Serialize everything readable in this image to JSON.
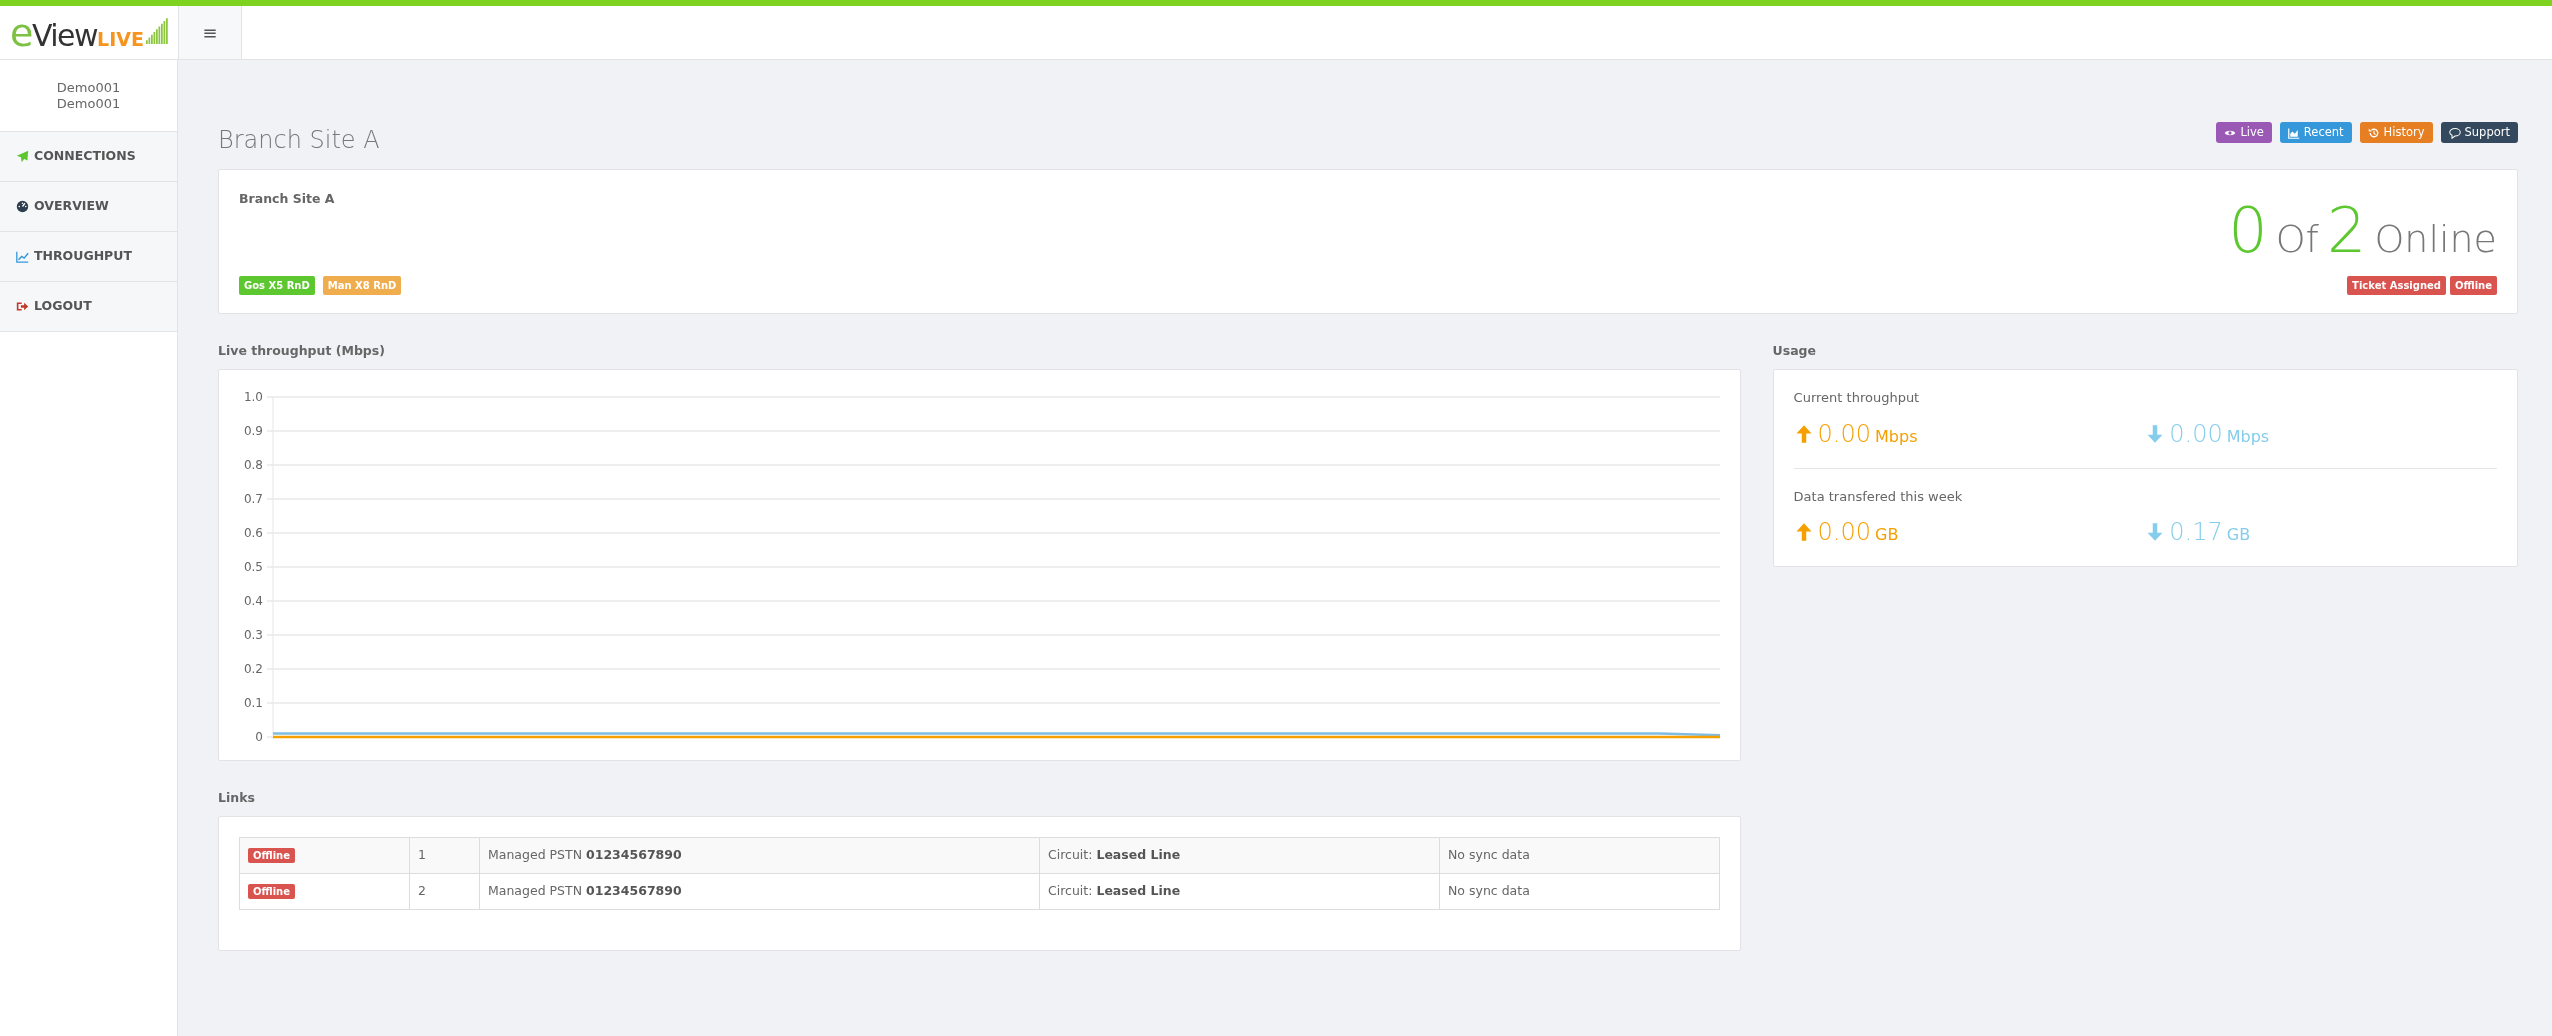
{
  "logo": {
    "mark": "e",
    "word": "View",
    "suffix": "LIVE"
  },
  "menu_button": "≡",
  "user": [
    "Demo001",
    "Demo001"
  ],
  "sidebar": {
    "items": [
      {
        "kind": "connections",
        "label": "CONNECTIONS"
      },
      {
        "kind": "overview",
        "label": "OVERVIEW"
      },
      {
        "kind": "throughput",
        "label": "THROUGHPUT"
      },
      {
        "kind": "logout",
        "label": "LOGOUT"
      }
    ]
  },
  "page_title": "Branch Site A",
  "view_buttons": [
    {
      "kind": "live",
      "label": "Live"
    },
    {
      "kind": "recent",
      "label": "Recent"
    },
    {
      "kind": "history",
      "label": "History"
    },
    {
      "kind": "support",
      "label": "Support"
    }
  ],
  "site": {
    "name": "Branch Site A",
    "online": "0",
    "of": "Of",
    "total": "2",
    "online_label": "Online",
    "tags": [
      {
        "label": "Gos X5 RnD",
        "color": "#5cc72e"
      },
      {
        "label": "Man X8 RnD",
        "color": "#f0ad4e"
      }
    ],
    "status_badges": [
      "Ticket Assigned",
      "Offline"
    ]
  },
  "throughput": {
    "label": "Live throughput (Mbps)",
    "chart_data": {
      "type": "line",
      "grid": true,
      "ylim": [
        0,
        1
      ],
      "yticks": [
        {
          "value": 0,
          "label": "0"
        },
        {
          "value": 0.1,
          "label": "0.1"
        },
        {
          "value": 0.2,
          "label": "0.2"
        },
        {
          "value": 0.3,
          "label": "0.3"
        },
        {
          "value": 0.4,
          "label": "0.4"
        },
        {
          "value": 0.5,
          "label": "0.5"
        },
        {
          "value": 0.6,
          "label": "0.6"
        },
        {
          "value": 0.7,
          "label": "0.7"
        },
        {
          "value": 0.8,
          "label": "0.8"
        },
        {
          "value": 0.9,
          "label": "0.9"
        },
        {
          "value": 1,
          "label": "1.0"
        }
      ],
      "series": [
        {
          "color": "#7dbde2",
          "values": [
            0.01,
            0.01,
            0.01,
            0.01,
            0.01,
            0.01,
            0.01,
            0.01,
            0.01,
            0.01,
            0.01,
            0.01,
            0.01,
            0.01,
            0.01,
            0.01,
            0.01,
            0.01,
            0.01,
            0.01,
            0.01,
            0.01,
            0.01,
            0.01,
            0.005
          ]
        },
        {
          "color": "#f5a000",
          "values": [
            0,
            0,
            0,
            0,
            0,
            0,
            0,
            0,
            0,
            0,
            0,
            0,
            0,
            0,
            0,
            0,
            0,
            0,
            0,
            0,
            0,
            0,
            0,
            0,
            0
          ]
        }
      ]
    }
  },
  "usage": {
    "label": "Usage",
    "sections": [
      {
        "label": "Current throughput",
        "stats": [
          {
            "kind": "up",
            "value": "0.00",
            "unit": "Mbps"
          },
          {
            "kind": "down",
            "value": "0.00",
            "unit": "Mbps"
          }
        ]
      },
      {
        "label": "Data transfered this week",
        "stats": [
          {
            "kind": "up",
            "value": "0.00",
            "unit": "GB"
          },
          {
            "kind": "down",
            "value": "0.17",
            "unit": "GB"
          }
        ]
      }
    ]
  },
  "links": {
    "label": "Links",
    "rows": [
      {
        "status": "Offline",
        "number": "1",
        "line": "Managed PSTN **01234567890**",
        "circuit": "Circuit: **Leased Line**",
        "sync": "No sync data"
      },
      {
        "status": "Offline",
        "number": "2",
        "line": "Managed PSTN **01234567890**",
        "circuit": "Circuit: **Leased Line**",
        "sync": "No sync data"
      }
    ]
  }
}
